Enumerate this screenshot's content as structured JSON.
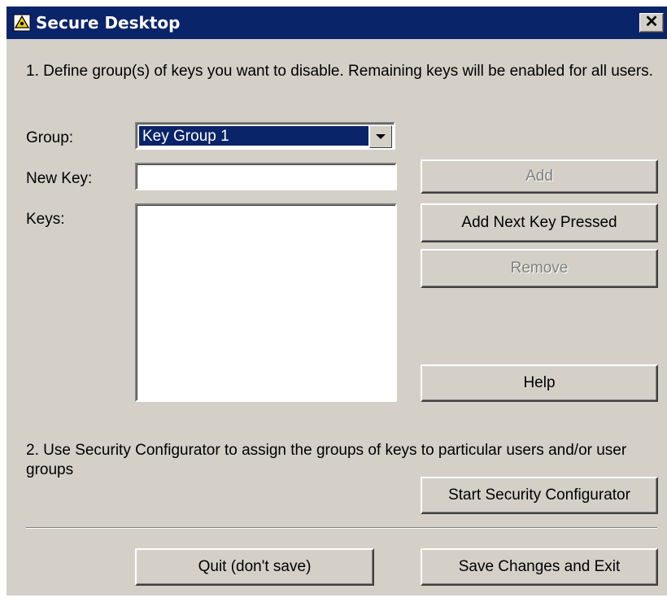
{
  "window": {
    "title": "Secure Desktop",
    "close_glyph": "✕"
  },
  "step1": {
    "instruction": "1. Define group(s) of keys you want to disable. Remaining keys will be enabled for all users.",
    "group_label": "Group:",
    "group_value": "Key Group 1",
    "new_key_label": "New Key:",
    "new_key_value": "",
    "keys_label": "Keys:",
    "keys": []
  },
  "buttons": {
    "add": "Add",
    "add_next": "Add Next Key Pressed",
    "remove": "Remove",
    "help": "Help",
    "start_config": "Start Security Configurator",
    "quit": "Quit (don't save)",
    "save_exit": "Save Changes and Exit"
  },
  "step2": {
    "instruction": "2. Use Security Configurator to assign the groups of keys to particular users and/or user groups"
  },
  "icons": {
    "app": "lock-shield-icon",
    "dropdown": "chevron-down-icon",
    "close": "close-icon"
  }
}
